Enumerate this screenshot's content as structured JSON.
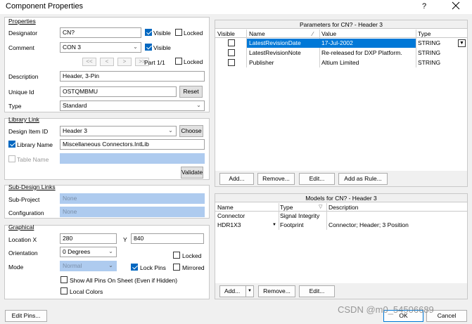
{
  "window": {
    "title": "Component Properties"
  },
  "properties": {
    "section": "Properties",
    "designator_label": "Designator",
    "designator_value": "CN?",
    "visible_label": "Visible",
    "locked_label": "Locked",
    "comment_label": "Comment",
    "comment_value": "CON 3",
    "comment_visible_label": "Visible",
    "nav": {
      "first": "<<",
      "prev": "<",
      "next": ">",
      "last": ">>"
    },
    "part_label": "Part 1/1",
    "part_locked_label": "Locked",
    "description_label": "Description",
    "description_value": "Header, 3-Pin",
    "unique_id_label": "Unique Id",
    "unique_id_value": "OSTQMBMU",
    "reset_label": "Reset",
    "type_label": "Type",
    "type_value": "Standard"
  },
  "library_link": {
    "section": "Library Link",
    "design_item_label": "Design Item ID",
    "design_item_value": "Header 3",
    "choose_label": "Choose",
    "library_name_label": "Library Name",
    "library_name_value": "Miscellaneous Connectors.IntLib",
    "table_name_label": "Table Name",
    "validate_label": "Validate"
  },
  "sub_design": {
    "section": "Sub-Design Links",
    "sub_project_label": "Sub-Project",
    "sub_project_value": "None",
    "configuration_label": "Configuration",
    "configuration_value": "None"
  },
  "graphical": {
    "section": "Graphical",
    "location_label": "Location X",
    "x_value": "280",
    "y_label": "Y",
    "y_value": "840",
    "orientation_label": "Orientation",
    "orientation_value": "0 Degrees",
    "locked_label": "Locked",
    "mode_label": "Mode",
    "mode_value": "Normal",
    "lock_pins_label": "Lock Pins",
    "mirrored_label": "Mirrored",
    "show_all_pins_label": "Show All Pins On Sheet (Even if Hidden)",
    "local_colors_label": "Local Colors"
  },
  "parameters": {
    "title": "Parameters for CN? - Header 3",
    "columns": [
      "Visible",
      "Name",
      "Value",
      "Type"
    ],
    "rows": [
      {
        "name": "LatestRevisionDate",
        "value": "17-Jul-2002",
        "type": "STRING"
      },
      {
        "name": "LatestRevisionNote",
        "value": "Re-released for DXP Platform.",
        "type": "STRING"
      },
      {
        "name": "Publisher",
        "value": "Altium Limited",
        "type": "STRING"
      }
    ],
    "buttons": {
      "add": "Add...",
      "remove": "Remove...",
      "edit": "Edit...",
      "add_as_rule": "Add as Rule..."
    }
  },
  "models": {
    "title": "Models for CN? - Header 3",
    "columns": [
      "Name",
      "Type",
      "Description"
    ],
    "rows": [
      {
        "name": "Connector",
        "type": "Signal Integrity",
        "description": ""
      },
      {
        "name": "HDR1X3",
        "type": "Footprint",
        "description": "Connector; Header; 3 Position"
      }
    ],
    "buttons": {
      "add": "Add...",
      "remove": "Remove...",
      "edit": "Edit..."
    }
  },
  "footer": {
    "edit_pins": "Edit Pins...",
    "ok": "OK",
    "cancel": "Cancel",
    "watermark": "CSDN @m0_54506689"
  },
  "colors": {
    "selection": "#0078d7",
    "disabled_field": "#aecbef"
  }
}
